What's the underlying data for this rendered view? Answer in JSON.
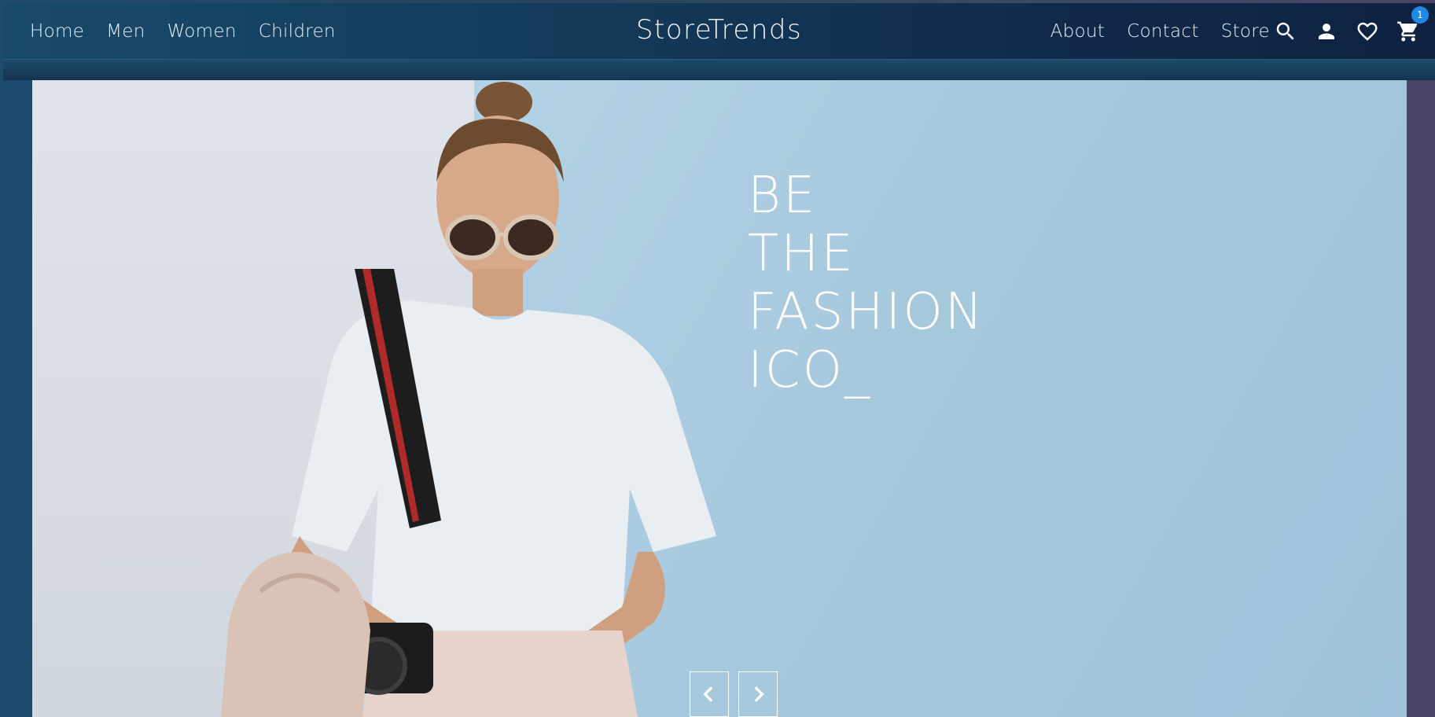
{
  "nav": {
    "left_links": [
      "Home",
      "Men",
      "Women",
      "Children"
    ],
    "brand": "StoreTrends",
    "right_links": [
      "About",
      "Contact",
      "Store"
    ]
  },
  "icons": {
    "search": "search-icon",
    "account": "user-icon",
    "wishlist": "heart-icon",
    "cart": "cart-icon",
    "cart_count": "1"
  },
  "hero": {
    "headline_lines": [
      "BE",
      "THE",
      "FASHION",
      "ICO_"
    ]
  },
  "colors": {
    "badge": "#1e88e5",
    "text": "#ffffff"
  }
}
